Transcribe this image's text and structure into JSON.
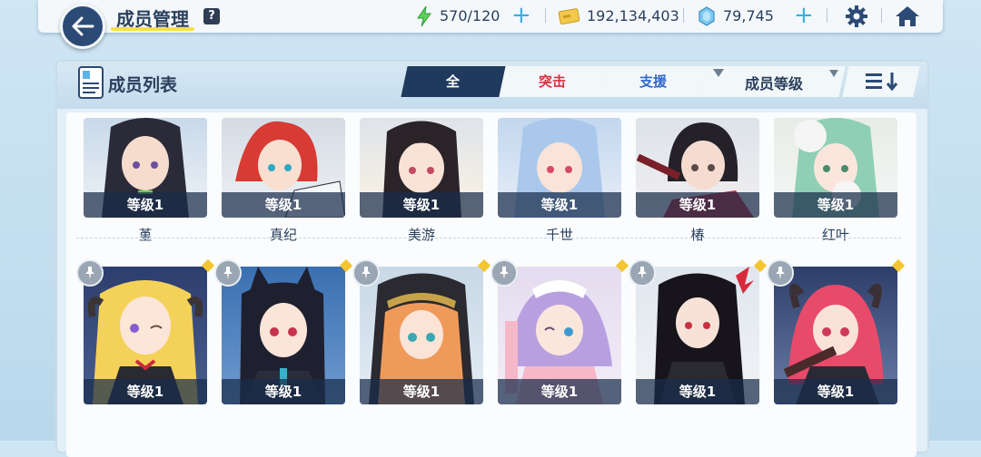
{
  "header": {
    "title": "成员管理",
    "help_icon": "?",
    "energy": "570/120",
    "credits": "192,134,403",
    "gems": "79,745",
    "icons": [
      "back-arrow-icon",
      "help-icon",
      "energy-bolt-icon",
      "credit-card-icon",
      "gem-icon",
      "plus-icon",
      "gear-icon",
      "home-icon"
    ]
  },
  "panel": {
    "title": "成员列表",
    "tabs": [
      "全",
      "突击",
      "支援"
    ],
    "sort_label": "成员等级"
  },
  "row1": [
    {
      "name": "堇",
      "level": "等级1"
    },
    {
      "name": "真纪",
      "level": "等级1"
    },
    {
      "name": "美游",
      "level": "等级1"
    },
    {
      "name": "千世",
      "level": "等级1"
    },
    {
      "name": "椿",
      "level": "等级1"
    },
    {
      "name": "红叶",
      "level": "等级1"
    }
  ],
  "row2": [
    {
      "level": "等级1"
    },
    {
      "level": "等级1"
    },
    {
      "level": "等级1"
    },
    {
      "level": "等级1"
    },
    {
      "level": "等级1"
    },
    {
      "level": "等级1"
    }
  ],
  "colors": {
    "accent": "#1f3a5c",
    "strike": "#d83040",
    "support": "#3068c8",
    "highlight": "#f5df4d"
  }
}
